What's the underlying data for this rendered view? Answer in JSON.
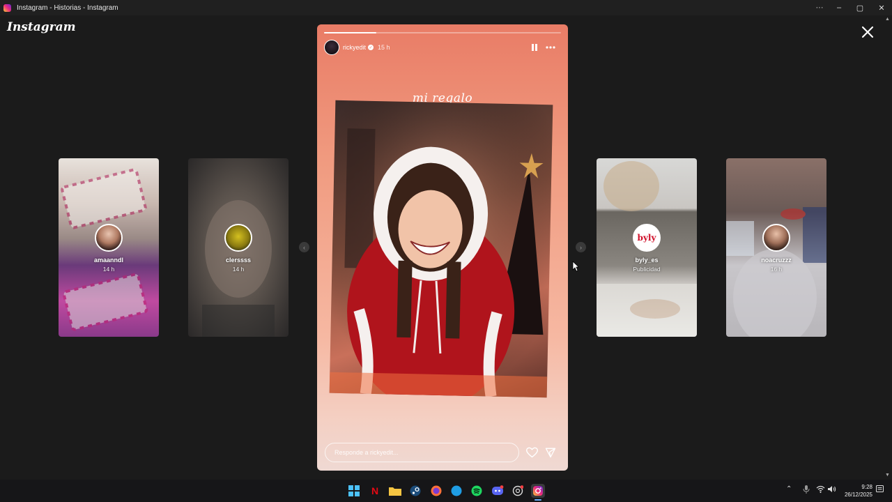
{
  "window": {
    "title": "Instagram - Historias - Instagram",
    "minimize": "–",
    "maximize": "▢",
    "close": "✕",
    "menu": "···"
  },
  "viewer": {
    "logo": "Instagram",
    "close_icon": "close-icon"
  },
  "previews": [
    {
      "username": "amaanndl",
      "time": "14 h"
    },
    {
      "username": "clerssss",
      "time": "14 h"
    },
    {
      "username": "byly_es",
      "time": "Publicidad",
      "avatar_text": "byly"
    },
    {
      "username": "noacruzzz",
      "time": "16 h"
    }
  ],
  "story": {
    "username": "rickyedit",
    "time": "15 h",
    "caption": "mi regalo",
    "progress": 0.22,
    "reply_placeholder": "Responde a rickyedit...",
    "verified": true
  },
  "taskbar": {
    "apps": [
      "windows-start",
      "netflix",
      "file-explorer",
      "steam",
      "firefox",
      "safari",
      "spotify",
      "discord",
      "chatgpt",
      "instagram"
    ],
    "clock_time": "9:28",
    "clock_date": "26/12/2025"
  },
  "colors": {
    "accent": "#e97c66",
    "background": "#1b1b1b",
    "taskbar": "#161618"
  }
}
